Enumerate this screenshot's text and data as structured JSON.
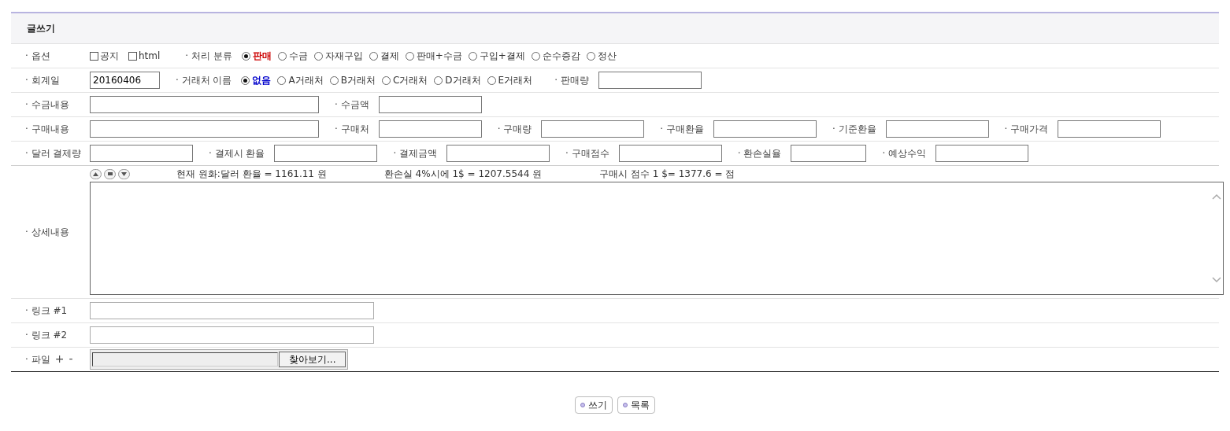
{
  "title": "글쓰기",
  "rows": [
    {
      "kind": "inline",
      "label": "· 옵션",
      "items": [
        {
          "kind": "checkbox",
          "label": "공지",
          "checked": false
        },
        {
          "kind": "checkbox",
          "label": "html",
          "checked": false
        },
        {
          "kind": "label",
          "text": "· 처리 분류"
        },
        {
          "kind": "radios",
          "color": "#cc0000",
          "options": [
            {
              "label": "판매",
              "selected": true
            },
            {
              "label": "수금",
              "selected": false
            },
            {
              "label": "자재구입",
              "selected": false
            },
            {
              "label": "결제",
              "selected": false
            },
            {
              "label": "판매+수금",
              "selected": false
            },
            {
              "label": "구입+결제",
              "selected": false
            },
            {
              "label": "순수증감",
              "selected": false
            },
            {
              "label": "정산",
              "selected": false
            }
          ]
        }
      ]
    },
    {
      "kind": "inline",
      "label": "· 회계일",
      "items": [
        {
          "kind": "field",
          "value": "20160406"
        },
        {
          "kind": "label",
          "text": "· 거래처 이름"
        },
        {
          "kind": "radios",
          "color": "#0000cc",
          "options": [
            {
              "label": "없음",
              "selected": true
            },
            {
              "label": "A거래처",
              "selected": false
            },
            {
              "label": "B거래처",
              "selected": false
            },
            {
              "label": "C거래처",
              "selected": false
            },
            {
              "label": "D거래처",
              "selected": false
            },
            {
              "label": "E거래처",
              "selected": false
            }
          ]
        },
        {
          "kind": "label",
          "text": "· 판매량"
        },
        {
          "kind": "field"
        }
      ]
    },
    {
      "kind": "inline",
      "label": "· 수금내용",
      "items": [
        {
          "kind": "field"
        },
        {
          "kind": "label",
          "text": "· 수금액"
        },
        {
          "kind": "field"
        }
      ]
    },
    {
      "kind": "inline",
      "label": "· 구매내용",
      "items": [
        {
          "kind": "field"
        },
        {
          "kind": "label",
          "text": "· 구매처"
        },
        {
          "kind": "field"
        },
        {
          "kind": "label",
          "text": "· 구매량"
        },
        {
          "kind": "field"
        },
        {
          "kind": "label",
          "text": "· 구매환율"
        },
        {
          "kind": "field"
        },
        {
          "kind": "label",
          "text": "· 기준환율"
        },
        {
          "kind": "field"
        },
        {
          "kind": "label",
          "text": "· 구매가격"
        },
        {
          "kind": "field"
        }
      ]
    },
    {
      "kind": "inline",
      "label": "· 달러 결제량",
      "items": [
        {
          "kind": "field"
        },
        {
          "kind": "label",
          "text": "· 결제시 환율"
        },
        {
          "kind": "field"
        },
        {
          "kind": "label",
          "text": "· 결제금액"
        },
        {
          "kind": "field"
        },
        {
          "kind": "label",
          "text": "· 구매점수"
        },
        {
          "kind": "field"
        },
        {
          "kind": "label",
          "text": "· 환손실율"
        },
        {
          "kind": "field"
        },
        {
          "kind": "label",
          "text": "· 예상수익"
        },
        {
          "kind": "field"
        }
      ]
    },
    {
      "kind": "detail",
      "label": "· 상세내용",
      "notes": [
        "현재 원화:달러 환율 = 1161.11 원",
        "환손실 4%시에 1$ = 1207.5544 원",
        "구매시 점수 1 $= 1377.6 = 점"
      ]
    },
    {
      "kind": "inline",
      "label": "· 링크 #1",
      "items": [
        {
          "kind": "field"
        }
      ]
    },
    {
      "kind": "inline",
      "label": "· 링크 #2",
      "items": [
        {
          "kind": "field"
        }
      ]
    },
    {
      "kind": "file",
      "label": "· 파일",
      "add": "+",
      "remove": "-",
      "browse": "찾아보기..."
    }
  ],
  "buttons": [
    "쓰기",
    "목록"
  ]
}
